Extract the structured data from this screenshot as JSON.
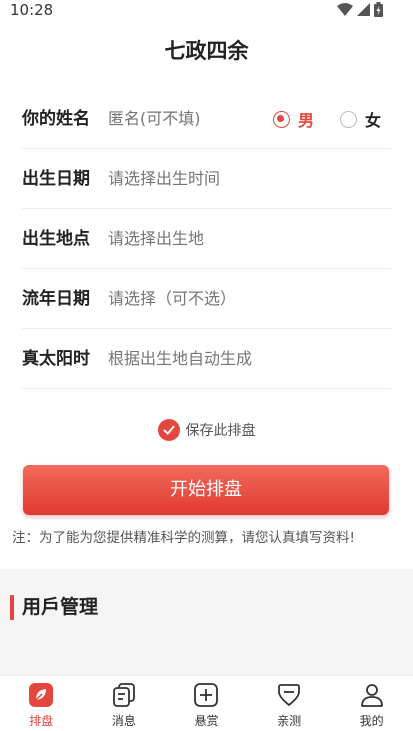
{
  "status_bar": {
    "time": "10:28"
  },
  "header": {
    "title": "七政四余"
  },
  "form": {
    "name": {
      "label": "你的姓名",
      "placeholder": "匿名(可不填)"
    },
    "gender": {
      "male": "男",
      "female": "女",
      "selected": "男"
    },
    "birth_date": {
      "label": "出生日期",
      "placeholder": "请选择出生时间"
    },
    "birth_place": {
      "label": "出生地点",
      "placeholder": "请选择出生地"
    },
    "flow_year": {
      "label": "流年日期",
      "placeholder": "请选择（可不选）"
    },
    "solar_time": {
      "label": "真太阳时",
      "placeholder": "根据出生地自动生成"
    }
  },
  "save_option": {
    "label": "保存此排盘",
    "checked": true
  },
  "start_button": {
    "label": "开始排盘"
  },
  "notice": "注：为了能为您提供精准科学的测算，请您认真填写资料!",
  "user_section": {
    "title": "用戶管理"
  },
  "tab_bar": {
    "items": [
      {
        "label": "排盘",
        "icon": "leaf-icon",
        "active": true
      },
      {
        "label": "消息",
        "icon": "document-icon",
        "active": false
      },
      {
        "label": "悬赏",
        "icon": "plus-box-icon",
        "active": false
      },
      {
        "label": "亲测",
        "icon": "shield-icon",
        "active": false
      },
      {
        "label": "我的",
        "icon": "user-icon",
        "active": false
      }
    ]
  },
  "colors": {
    "accent": "#e5473e"
  }
}
